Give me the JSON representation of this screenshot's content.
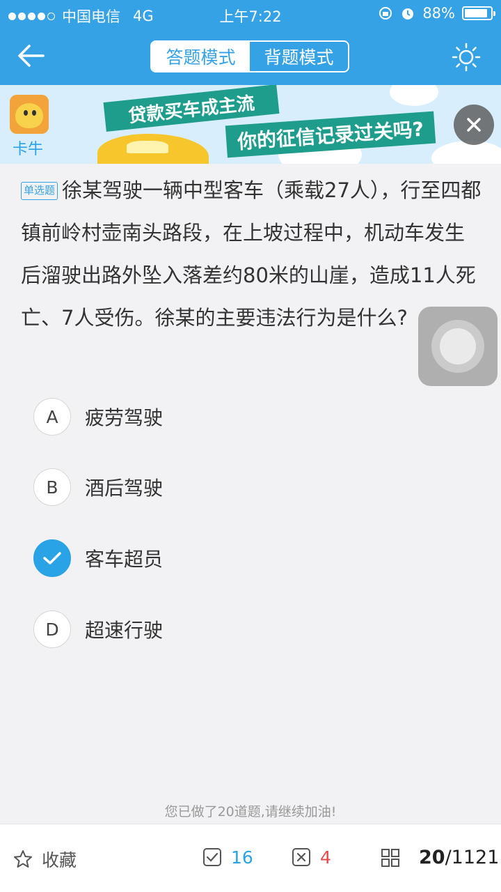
{
  "status_bar": {
    "carrier": "中国电信",
    "network": "4G",
    "time": "上午7:22",
    "battery": "88%",
    "battery_level": 0.88
  },
  "nav": {
    "tabs": [
      {
        "label": "答题模式",
        "active": true
      },
      {
        "label": "背题模式",
        "active": false
      }
    ]
  },
  "ad": {
    "logo_text": "卡牛",
    "headline1": "贷款买车成主流",
    "headline2": "你的征信记录过关吗?"
  },
  "question": {
    "type_tag": "单选题",
    "text": "徐某驾驶一辆中型客车（乘载27人），行至四都镇前岭村壶南头路段，在上坡过程中，机动车发生后溜驶出路外坠入落差约80米的山崖，造成11人死亡、7人受伤。徐某的主要违法行为是什么?"
  },
  "options": [
    {
      "letter": "A",
      "text": "疲劳驾驶",
      "selected": false
    },
    {
      "letter": "B",
      "text": "酒后驾驶",
      "selected": false
    },
    {
      "letter": "C",
      "text": "客车超员",
      "selected": true
    },
    {
      "letter": "D",
      "text": "超速行驶",
      "selected": false
    }
  ],
  "progress_hint": "您已做了20道题,请继续加油!",
  "bottom_bar": {
    "favorite_label": "收藏",
    "correct_count": "16",
    "wrong_count": "4",
    "current": "20",
    "total": "/1121"
  },
  "colors": {
    "primary": "#35a2e6",
    "wrong": "#e64b4b"
  }
}
